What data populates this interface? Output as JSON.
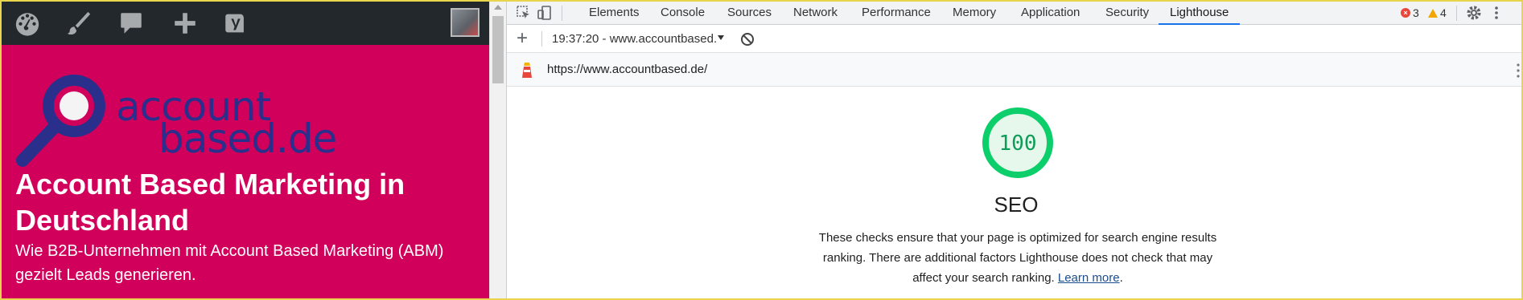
{
  "site": {
    "logo_line1": "account",
    "logo_line2": "based.de",
    "hero_title": "Account Based Marketing in Deutschland",
    "hero_subtitle": "Wie B2B-Unternehmen mit Account Based Marketing (ABM) gezielt Leads generieren."
  },
  "devtools": {
    "tabs": [
      {
        "label": "Elements"
      },
      {
        "label": "Console"
      },
      {
        "label": "Sources"
      },
      {
        "label": "Network"
      },
      {
        "label": "Performance"
      },
      {
        "label": "Memory"
      },
      {
        "label": "Application"
      },
      {
        "label": "Security"
      },
      {
        "label": "Lighthouse",
        "active": true
      }
    ],
    "error_count": "3",
    "warning_count": "4",
    "report_selector": "19:37:20 - www.accountbased.",
    "url": "https://www.accountbased.de/",
    "score": "100",
    "category_title": "SEO",
    "description": "These checks ensure that your page is optimized for search engine results ranking. There are additional factors Lighthouse does not check that may affect your search ranking. ",
    "learn_more": "Learn more",
    "period": "."
  },
  "colors": {
    "brand_pink": "#d1005a",
    "logo_navy": "#2a2f8c",
    "score_green": "#0c9d58",
    "active_tab": "#1a73e8"
  },
  "icons": [
    "dashboard-icon",
    "brush-icon",
    "comment-icon",
    "plus-icon",
    "yoast-icon",
    "inspect-icon",
    "device-toggle-icon",
    "settings-gear-icon",
    "more-vert-icon",
    "add-icon",
    "clear-icon",
    "lighthouse-icon"
  ]
}
